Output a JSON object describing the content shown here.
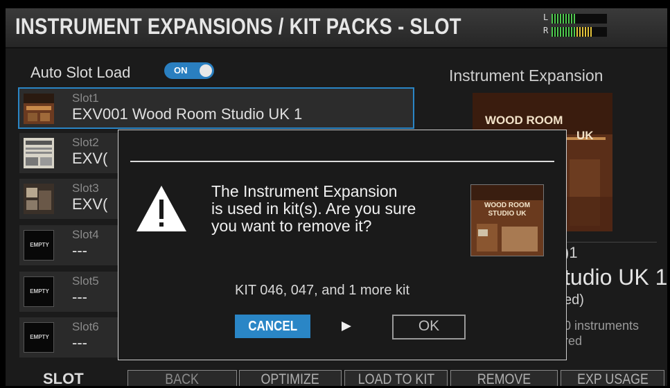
{
  "header": {
    "title": "INSTRUMENT EXPANSIONS / KIT PACKS - SLOT",
    "meter_left_label": "L",
    "meter_right_label": "R"
  },
  "auto_slot_load": {
    "label": "Auto Slot Load",
    "toggle_label": "ON",
    "on": true
  },
  "slots": [
    {
      "name": "Slot1",
      "value": "EXV001  Wood Room Studio UK 1",
      "empty": false
    },
    {
      "name": "Slot2",
      "value": "EXV(",
      "empty": false
    },
    {
      "name": "Slot3",
      "value": "EXV(",
      "empty": false
    },
    {
      "name": "Slot4",
      "value": "---",
      "empty": true,
      "thumb_label": "EMPTY"
    },
    {
      "name": "Slot5",
      "value": "---",
      "empty": true,
      "thumb_label": "EMPTY"
    },
    {
      "name": "Slot6",
      "value": "---",
      "empty": true,
      "thumb_label": "EMPTY"
    }
  ],
  "right_panel": {
    "title": "Instrument Expansion",
    "cover_line1": "WOOD ROOM",
    "cover_line2": "UK",
    "partial_id": ")1",
    "partial_name": "tudio UK 1",
    "partial_status": "ed)",
    "partial_instruments": "0 instruments",
    "partial_red": "red"
  },
  "dialog": {
    "message_lines": [
      "The Instrument Expansion",
      "is used in kit(s). Are you sure",
      "you want to remove it?"
    ],
    "kits_text": "KIT 046, 047, and 1 more kit",
    "cancel_label": "CANCEL",
    "ok_label": "OK",
    "cover_lines": [
      "WOOD ROOM",
      "STUDIO UK"
    ]
  },
  "bottom_bar": {
    "slot_label": "SLOT",
    "buttons": [
      "BACK",
      "OPTIMIZE",
      "LOAD TO KIT",
      "REMOVE",
      "EXP USAGE"
    ]
  },
  "colors": {
    "accent": "#2a86c6",
    "background": "#1b1b1b",
    "meter_green": "#4fc94f",
    "meter_yellow": "#e5c43a"
  },
  "icons": {
    "warning": "warning-triangle-icon",
    "arrow": "right-arrow-icon"
  }
}
